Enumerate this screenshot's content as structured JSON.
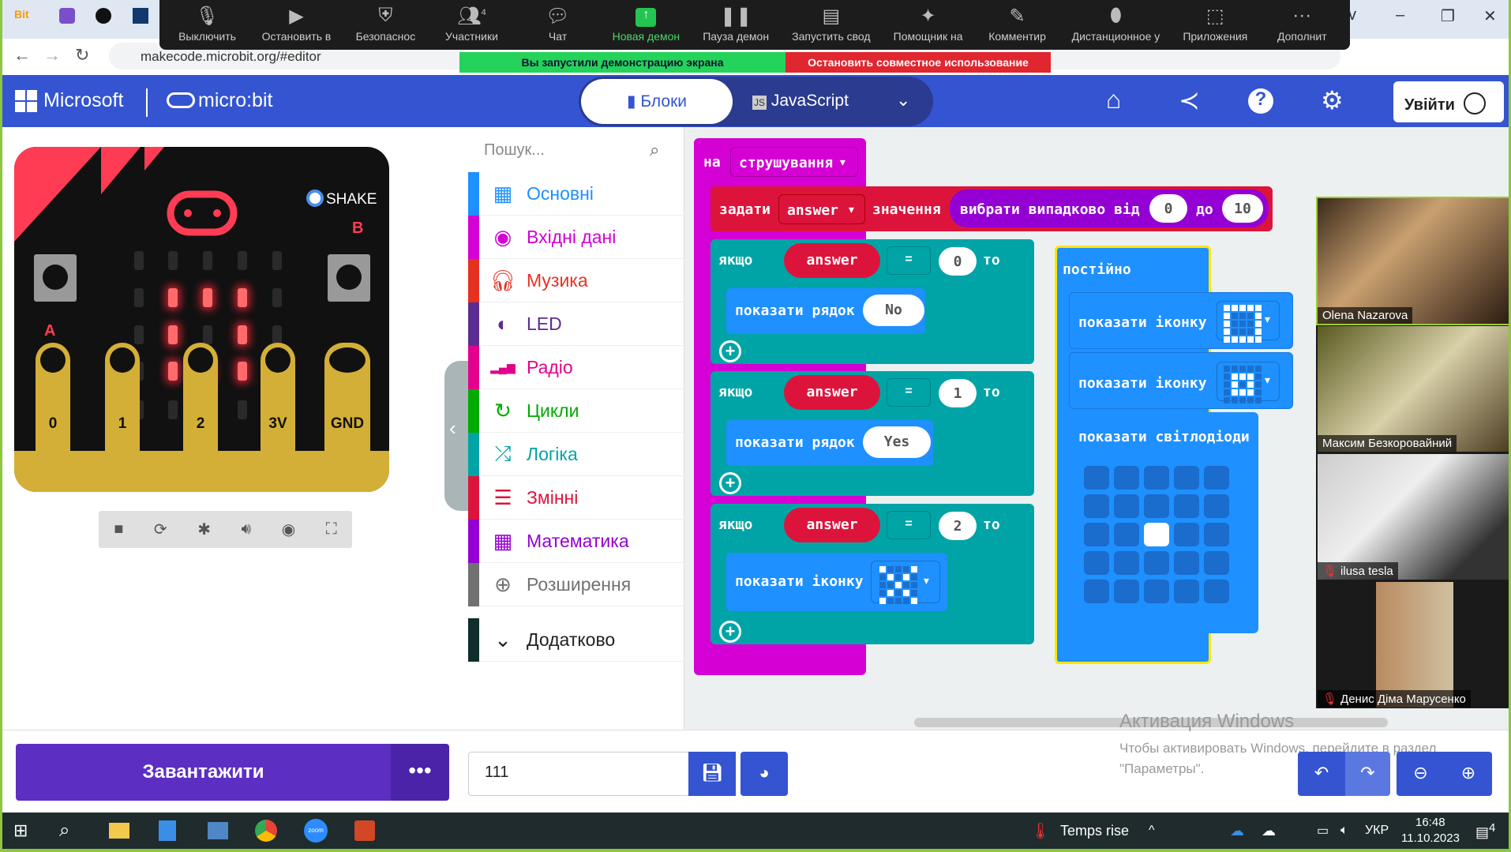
{
  "browser": {
    "url": "makecode.microbit.org/#editor",
    "window_controls": [
      "v",
      "–",
      "❐",
      "✕"
    ]
  },
  "zoom_toolbar": {
    "items": [
      {
        "label": "Выключить",
        "icon": "mic-icon"
      },
      {
        "label": "Остановить в",
        "icon": "video-icon"
      },
      {
        "label": "Безопаснос",
        "icon": "shield-icon"
      },
      {
        "label": "Участники",
        "icon": "participants-icon",
        "count": "4"
      },
      {
        "label": "Чат",
        "icon": "chat-icon"
      },
      {
        "label": "Новая демон",
        "icon": "share-screen-icon",
        "active": true
      },
      {
        "label": "Пауза демон",
        "icon": "pause-icon"
      },
      {
        "label": "Запустить свод",
        "icon": "summary-icon"
      },
      {
        "label": "Помощник на",
        "icon": "sparkle-icon"
      },
      {
        "label": "Комментир",
        "icon": "pen-icon"
      },
      {
        "label": "Дистанционное у",
        "icon": "mouse-icon"
      },
      {
        "label": "Приложения",
        "icon": "apps-icon"
      },
      {
        "label": "Дополнит",
        "icon": "more-icon"
      }
    ],
    "share_banner": "Вы запустили демонстрацию экрана",
    "stop_share": "Остановить совместное использование"
  },
  "header": {
    "microsoft": "Microsoft",
    "product": "micro:bit",
    "tab_blocks": "Блоки",
    "tab_js": "JavaScript",
    "login": "Увійти",
    "accent": "#3454d1"
  },
  "simulator": {
    "shake_label": "SHAKE",
    "button_a": "A",
    "button_b": "B",
    "pins": [
      "0",
      "1",
      "2",
      "3V",
      "GND"
    ],
    "leds": [
      [
        0,
        0,
        0,
        0,
        0
      ],
      [
        0,
        1,
        1,
        1,
        0
      ],
      [
        0,
        1,
        0,
        1,
        0
      ],
      [
        0,
        1,
        1,
        1,
        0
      ],
      [
        0,
        0,
        0,
        0,
        0
      ]
    ]
  },
  "toolbox": {
    "search_placeholder": "Пошук...",
    "categories": [
      {
        "label": "Основні",
        "color": "#1e90ff",
        "icon": "grid-icon"
      },
      {
        "label": "Вхідні дані",
        "color": "#d400d4",
        "icon": "circle-icon"
      },
      {
        "label": "Музика",
        "color": "#e63022",
        "icon": "headphones-icon"
      },
      {
        "label": "LED",
        "color": "#5c2d91",
        "icon": "toggle-icon"
      },
      {
        "label": "Радіо",
        "color": "#e3008c",
        "icon": "signal-icon"
      },
      {
        "label": "Цикли",
        "color": "#00aa00",
        "icon": "loop-icon"
      },
      {
        "label": "Логіка",
        "color": "#00a4a6",
        "icon": "shuffle-icon"
      },
      {
        "label": "Змінні",
        "color": "#dc143c",
        "icon": "list-icon"
      },
      {
        "label": "Математика",
        "color": "#9400d3",
        "icon": "calculator-icon"
      },
      {
        "label": "Розширення",
        "color": "#717171",
        "icon": "plus-circle-icon"
      },
      {
        "label": "Додатково",
        "color": "#0f2e2b",
        "icon": "chevron-down-icon"
      }
    ]
  },
  "blocks": {
    "on": "на",
    "event": "струшування",
    "set": "задати",
    "var": "answer",
    "value": "значення",
    "random": "вибрати випадково від",
    "from": "0",
    "to_word": "до",
    "to": "10",
    "if": "якщо",
    "then": "то",
    "eq": "=",
    "cases": [
      {
        "n": "0",
        "action": "показати рядок",
        "text": "No"
      },
      {
        "n": "1",
        "action": "показати рядок",
        "text": "Yes"
      },
      {
        "n": "2",
        "action": "показати іконку"
      }
    ],
    "icon_case2": [
      [
        1,
        0,
        0,
        0,
        1
      ],
      [
        0,
        1,
        0,
        1,
        0
      ],
      [
        0,
        0,
        1,
        0,
        0
      ],
      [
        0,
        1,
        0,
        1,
        0
      ],
      [
        1,
        0,
        0,
        0,
        1
      ]
    ],
    "forever": "постійно",
    "show_icon": "показати іконку",
    "show_leds": "показати світлодіоди",
    "icon_a": [
      [
        1,
        1,
        1,
        1,
        1
      ],
      [
        1,
        0,
        0,
        0,
        1
      ],
      [
        1,
        0,
        0,
        0,
        1
      ],
      [
        1,
        0,
        0,
        0,
        1
      ],
      [
        1,
        1,
        1,
        1,
        1
      ]
    ],
    "icon_b": [
      [
        0,
        0,
        0,
        0,
        0
      ],
      [
        0,
        1,
        1,
        1,
        0
      ],
      [
        0,
        1,
        0,
        1,
        0
      ],
      [
        0,
        1,
        1,
        1,
        0
      ],
      [
        0,
        0,
        0,
        0,
        0
      ]
    ],
    "leds": [
      [
        0,
        0,
        0,
        0,
        0
      ],
      [
        0,
        0,
        0,
        0,
        0
      ],
      [
        0,
        0,
        1,
        0,
        0
      ],
      [
        0,
        0,
        0,
        0,
        0
      ],
      [
        0,
        0,
        0,
        0,
        0
      ]
    ]
  },
  "participants": [
    {
      "name": "Olena Nazarova",
      "muted": false
    },
    {
      "name": "Максим Безкоровайний",
      "muted": false
    },
    {
      "name": "ilusa tesla",
      "muted": true
    },
    {
      "name": "Денис Діма Марусенко",
      "muted": true
    }
  ],
  "bottom": {
    "download": "Завантажити",
    "more": "•••",
    "project_name": "111"
  },
  "watermark": {
    "title": "Активация Windows",
    "text": "Чтобы активировать Windows, перейдите в раздел \"Параметры\"."
  },
  "taskbar": {
    "weather": "Temps rise",
    "lang": "УКР",
    "time": "16:48",
    "date": "11.10.2023",
    "notifications": "4"
  }
}
